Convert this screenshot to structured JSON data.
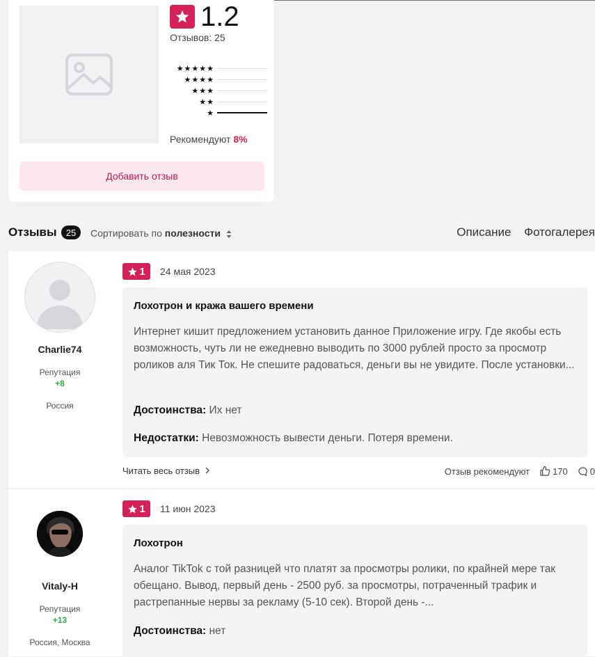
{
  "summary": {
    "score": "1.2",
    "review_count_text": "Отзывов: 25",
    "bars": [
      {
        "stars": "★★★★★",
        "fraction": 0.0
      },
      {
        "stars": "★★★★",
        "fraction": 0.0
      },
      {
        "stars": "★★★",
        "fraction": 0.0
      },
      {
        "stars": "★★",
        "fraction": 0.0
      },
      {
        "stars": "★",
        "fraction": 1.0
      }
    ],
    "recommend_label": "Рекомендуют",
    "recommend_value": "8%",
    "add_review_label": "Добавить отзыв"
  },
  "section": {
    "title": "Отзывы",
    "count": "25",
    "sort_prefix": "Сортировать по",
    "sort_value": "полезности",
    "tabs": [
      "Описание",
      "Фотогалерея"
    ]
  },
  "reviews": [
    {
      "author": "Charlie74",
      "reputation_label": "Репутация",
      "reputation": "+8",
      "country": "Россия",
      "rating": "1",
      "date": "24 мая 2023",
      "title": "Лохотрон и кража вашего времени",
      "text": "Интернет кишит предложением установить данное Приложение игру. Где якобы есть возможность, чуть ли не ежедневно выводить по 3000 рублей просто за просмотр роликов аля Тик Ток. Не спешите радоваться, деньги вы не увидите. После установки...",
      "pros_label": "Достоинства:",
      "pros": "Их нет",
      "cons_label": "Недостатки:",
      "cons": "Невозможность вывести деньги. Потеря времени.",
      "read_all": "Читать весь отзыв",
      "recommend_text": "Отзыв рекомендуют",
      "likes": "170",
      "comments": "0"
    },
    {
      "author": "Vitaly-H",
      "reputation_label": "Репутация",
      "reputation": "+13",
      "country": "Россия, Москва",
      "rating": "1",
      "date": "11 июн 2023",
      "title": "Лохотрон",
      "text": "Аналог TikTok с той разницей что платят за просмотры ролики, по крайней мере так обещано. Вывод, первый день - 2500 руб. за просмотры, потраченный трафик и растрепанные нервы за рекламу (5-10 сек). Второй день -...",
      "pros_label": "Достоинства:",
      "pros": "нет"
    }
  ]
}
